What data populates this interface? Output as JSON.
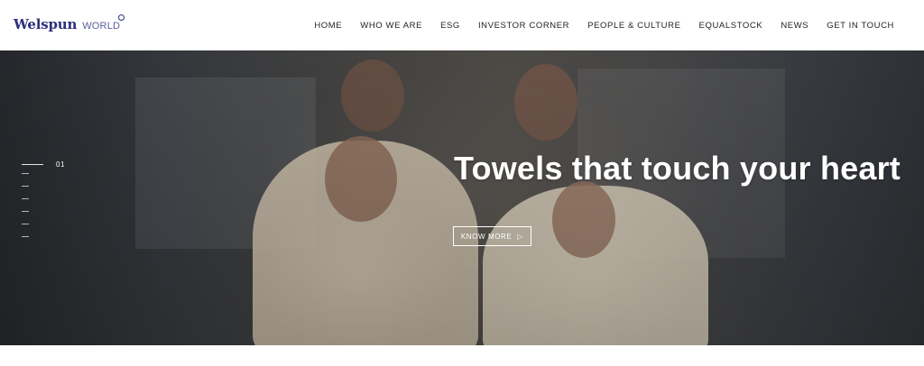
{
  "logo": {
    "main": "Welspun",
    "sub": "WORLD"
  },
  "nav": [
    "HOME",
    "WHO WE ARE",
    "ESG",
    "INVESTOR CORNER",
    "PEOPLE & CULTURE",
    "EQUALSTOCK",
    "NEWS",
    "GET IN TOUCH"
  ],
  "hero": {
    "slide_number": "01",
    "title": "Towels that touch your heart",
    "cta_label": "KNOW MORE",
    "cta_arrow": "▷"
  },
  "colors": {
    "brand": "#2c2f7c",
    "hero_text": "#ffffff"
  }
}
